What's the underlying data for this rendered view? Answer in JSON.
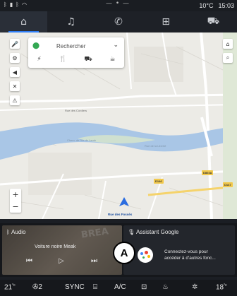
{
  "status_bar": {
    "icons": [
      "bluetooth-icon",
      "signal-icon",
      "bluetooth-icon",
      "wifi-icon"
    ],
    "center_dots": "— • —",
    "temperature": "10°C",
    "time": "15:03"
  },
  "nav_tabs": [
    {
      "name": "home",
      "icon": "⌂",
      "active": true
    },
    {
      "name": "music",
      "icon": "♫",
      "active": false
    },
    {
      "name": "phone",
      "icon": "✆",
      "active": false
    },
    {
      "name": "apps",
      "icon": "⊞",
      "active": false
    },
    {
      "name": "vehicle",
      "icon": "⛟",
      "active": false
    }
  ],
  "map": {
    "search_placeholder": "Rechercher",
    "categories": [
      "gas-station-icon",
      "restaurant-icon",
      "shopping-icon",
      "cafe-icon"
    ],
    "street_labels": [
      "Rue des Cordiers",
      "Chem. de l'Ile de Lamb",
      "Rue de la Liberté"
    ],
    "road_badges": [
      "D146",
      "D803A",
      "D147"
    ],
    "position_label": "Rue des Fossés",
    "river_color": "#a9c6e6"
  },
  "widgets": {
    "audio": {
      "header": "Audio",
      "track": "Voiture noire",
      "artist": "Meak",
      "art_text": "BREA"
    },
    "assistant": {
      "header": "Assistant Google",
      "message_line1": "Connectez-vous pour",
      "message_line2": "accéder à d'autres fonc..."
    }
  },
  "callout_label": "A",
  "climate": {
    "left_temp": "21",
    "left_unit": "°c",
    "fan_level": "2",
    "sync": "SYNC",
    "ac": "A/C",
    "right_temp": "18",
    "right_unit": "°c"
  },
  "accent_color": "#2f7df6"
}
